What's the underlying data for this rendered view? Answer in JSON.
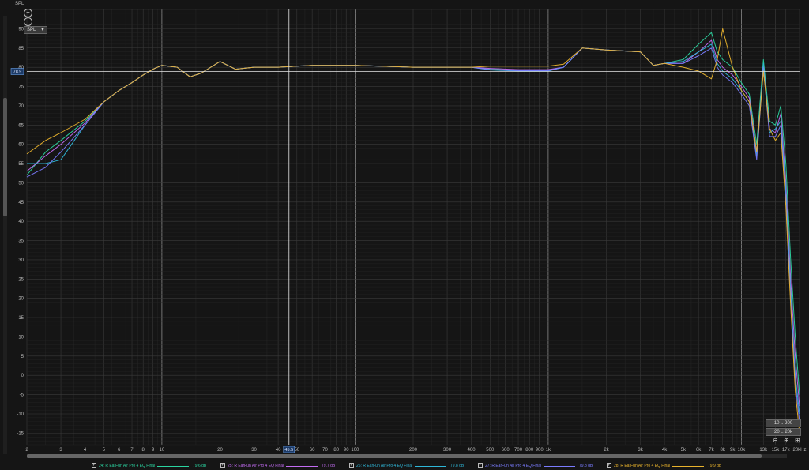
{
  "y_axis_name": "SPL",
  "dropdown_label": "SPL",
  "cursor_level_label": "78.9",
  "cursor_freq_label": "45.5",
  "range_buttons": [
    "10 .. 200",
    "20 .. 20k"
  ],
  "colors": {
    "background": "#151515",
    "grid_major": "#3a3a3a",
    "grid_minor": "#262626",
    "cursor": "#e6e6e6",
    "series": [
      "#2bd4a0",
      "#c26cf2",
      "#2fb7d8",
      "#7a7cff",
      "#e8b22c"
    ]
  },
  "legend": [
    {
      "name": "24: R EarFun Air Pro 4 EQ Final",
      "value": "79.6 dB",
      "checked": true
    },
    {
      "name": "25: R EarFun Air Pro 4 EQ Final",
      "value": "79.7 dB",
      "checked": true
    },
    {
      "name": "26: R EarFun Air Pro 4 EQ Final",
      "value": "79.8 dB",
      "checked": true
    },
    {
      "name": "27: R EarFun Air Pro 4 EQ Final",
      "value": "79.8 dB",
      "checked": true
    },
    {
      "name": "28: R EarFun Air Pro 4 EQ Final",
      "value": "79.9 dB",
      "checked": true
    }
  ],
  "chart_data": {
    "type": "line",
    "title": "",
    "xlabel": "",
    "ylabel": "SPL",
    "x_scale": "log",
    "xlim": [
      2,
      20000
    ],
    "ylim": [
      -18,
      95
    ],
    "grid": true,
    "legend_placement": "bottom",
    "x_ticks": [
      {
        "v": 2,
        "label": "2"
      },
      {
        "v": 3,
        "label": "3"
      },
      {
        "v": 4,
        "label": "4"
      },
      {
        "v": 5,
        "label": "5"
      },
      {
        "v": 6,
        "label": "6"
      },
      {
        "v": 7,
        "label": "7"
      },
      {
        "v": 8,
        "label": "8"
      },
      {
        "v": 9,
        "label": "9"
      },
      {
        "v": 10,
        "label": "10"
      },
      {
        "v": 20,
        "label": "20"
      },
      {
        "v": 30,
        "label": "30"
      },
      {
        "v": 40,
        "label": "40"
      },
      {
        "v": 50,
        "label": "50"
      },
      {
        "v": 60,
        "label": "60"
      },
      {
        "v": 70,
        "label": "70"
      },
      {
        "v": 80,
        "label": "80"
      },
      {
        "v": 90,
        "label": "90"
      },
      {
        "v": 100,
        "label": "100"
      },
      {
        "v": 200,
        "label": "200"
      },
      {
        "v": 300,
        "label": "300"
      },
      {
        "v": 400,
        "label": "400"
      },
      {
        "v": 500,
        "label": "500"
      },
      {
        "v": 600,
        "label": "600"
      },
      {
        "v": 700,
        "label": "700"
      },
      {
        "v": 800,
        "label": "800"
      },
      {
        "v": 900,
        "label": "900"
      },
      {
        "v": 1000,
        "label": "1k"
      },
      {
        "v": 2000,
        "label": "2k"
      },
      {
        "v": 3000,
        "label": "3k"
      },
      {
        "v": 4000,
        "label": "4k"
      },
      {
        "v": 5000,
        "label": "5k"
      },
      {
        "v": 6000,
        "label": "6k"
      },
      {
        "v": 7000,
        "label": "7k"
      },
      {
        "v": 8000,
        "label": "8k"
      },
      {
        "v": 9000,
        "label": "9k"
      },
      {
        "v": 10000,
        "label": "10k"
      },
      {
        "v": 13000,
        "label": "13k"
      },
      {
        "v": 15000,
        "label": "15k"
      },
      {
        "v": 17000,
        "label": "17k"
      },
      {
        "v": 20000,
        "label": "20kHz"
      }
    ],
    "y_ticks": [
      90,
      85,
      80,
      75,
      70,
      65,
      60,
      55,
      50,
      45,
      40,
      35,
      30,
      25,
      20,
      15,
      10,
      5,
      0,
      -5,
      -10,
      -15
    ],
    "cursor": {
      "x": 45.5,
      "y": 78.9
    },
    "x": [
      2,
      2.5,
      3,
      4,
      5,
      6,
      7,
      8,
      9,
      10,
      12,
      14,
      16,
      20,
      24,
      30,
      40,
      60,
      100,
      200,
      400,
      500,
      700,
      1000,
      1200,
      1500,
      2000,
      3000,
      3500,
      4000,
      5000,
      6000,
      7000,
      7500,
      8000,
      9000,
      10000,
      11000,
      12000,
      13000,
      14000,
      15000,
      16000,
      17000,
      18000,
      19000,
      20000
    ],
    "series": [
      {
        "name": "24: R EarFun Air Pro 4 EQ Final",
        "values": [
          52,
          58,
          61,
          66,
          71,
          74,
          76,
          78,
          79.5,
          80.5,
          80,
          77.5,
          78.5,
          81.5,
          79.5,
          80,
          80,
          80.5,
          80.5,
          80,
          80,
          79.5,
          79.2,
          79.2,
          80,
          85,
          84.5,
          84,
          80.5,
          81,
          82,
          86,
          89,
          84,
          82,
          80,
          76,
          73,
          60,
          82,
          66,
          65,
          70,
          55,
          30,
          10,
          -5
        ]
      },
      {
        "name": "25: R EarFun Air Pro 4 EQ Final",
        "values": [
          53,
          57,
          60,
          65.5,
          71,
          74,
          76,
          78,
          79.5,
          80.5,
          80,
          77.5,
          78.5,
          81.5,
          79.5,
          80,
          80,
          80.5,
          80.5,
          80,
          80,
          79.7,
          79.4,
          79.4,
          80,
          85,
          84.5,
          84,
          80.5,
          81,
          81,
          84,
          87,
          82,
          80,
          78,
          75,
          72,
          58,
          80,
          64,
          63,
          68,
          50,
          25,
          5,
          -8
        ]
      },
      {
        "name": "26: R EarFun Air Pro 4 EQ Final",
        "values": [
          55,
          55,
          56,
          65,
          71,
          74,
          76,
          78,
          79.5,
          80.5,
          80,
          77.5,
          78.5,
          81.5,
          79.5,
          80,
          80,
          80.5,
          80.5,
          80,
          80,
          79.3,
          79,
          79,
          80,
          85,
          84.5,
          84,
          80.5,
          81,
          81.5,
          84,
          86,
          81,
          79,
          77,
          74,
          71,
          57,
          81,
          63,
          64,
          66,
          48,
          22,
          0,
          -10
        ]
      },
      {
        "name": "27: R EarFun Air Pro 4 EQ Final",
        "values": [
          51.5,
          54,
          58,
          65,
          71,
          74,
          76,
          78,
          79.5,
          80.5,
          80,
          77.5,
          78.5,
          81.5,
          79.5,
          80,
          80,
          80.5,
          80.5,
          80,
          80,
          79.4,
          79.1,
          79.1,
          80,
          85,
          84.5,
          84,
          80.5,
          81,
          81,
          83,
          85,
          80,
          78,
          76,
          73,
          70,
          56,
          80,
          62,
          62,
          65,
          46,
          20,
          -2,
          -12
        ]
      },
      {
        "name": "28: R EarFun Air Pro 4 EQ Final",
        "values": [
          57.5,
          61,
          63,
          66.5,
          71,
          74,
          76,
          78,
          79.5,
          80.5,
          80,
          77.5,
          78.5,
          81.5,
          79.5,
          80,
          80,
          80.5,
          80.5,
          80,
          80,
          80.3,
          80.3,
          80.3,
          80.8,
          85,
          84.5,
          84,
          80.5,
          81,
          80,
          79,
          77,
          82,
          90,
          80,
          74,
          71,
          58,
          79,
          64,
          61,
          63,
          44,
          18,
          -4,
          -15
        ]
      }
    ]
  }
}
